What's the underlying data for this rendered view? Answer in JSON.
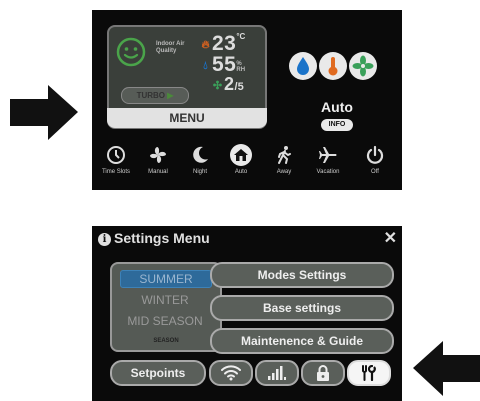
{
  "main_screen": {
    "indoor_air_quality_label": "Indoor Air Quality",
    "temperature": "23",
    "temperature_unit": "°C",
    "humidity": "55",
    "humidity_unit_top": "%",
    "humidity_unit_bottom": "RH",
    "speed": "2",
    "speed_max": "/5",
    "turbo_label": "TURBO",
    "menu_label": "MENU",
    "mode_label": "Auto",
    "info_label": "INFO",
    "nav": [
      {
        "label": "Time Slots",
        "icon": "clock-icon"
      },
      {
        "label": "Manual",
        "icon": "fan-icon"
      },
      {
        "label": "Night",
        "icon": "moon-icon"
      },
      {
        "label": "Auto",
        "icon": "home-icon"
      },
      {
        "label": "Away",
        "icon": "walking-person-icon"
      },
      {
        "label": "Vacation",
        "icon": "airplane-icon"
      },
      {
        "label": "Off",
        "icon": "power-icon"
      }
    ]
  },
  "settings_screen": {
    "title": "Settings Menu",
    "close_icon": "close-icon",
    "seasons": [
      "SUMMER",
      "WINTER",
      "MID SEASON"
    ],
    "selected_season": "SUMMER",
    "season_label": "SEASON",
    "buttons": {
      "modes": "Modes Settings",
      "base": "Base settings",
      "maintenance": "Maintenence & Guide",
      "setpoints": "Setpoints"
    },
    "icon_buttons": [
      "wifi-icon",
      "signal-bars-icon",
      "lock-icon",
      "tools-icon"
    ]
  },
  "colors": {
    "screen_bg": "#0a0a0a",
    "smiley": "#4aa44a",
    "season_selected": "#2e6a9a",
    "water_drop": "#1a73c9",
    "thermometer": "#e06a20",
    "fan": "#3aa05a"
  }
}
